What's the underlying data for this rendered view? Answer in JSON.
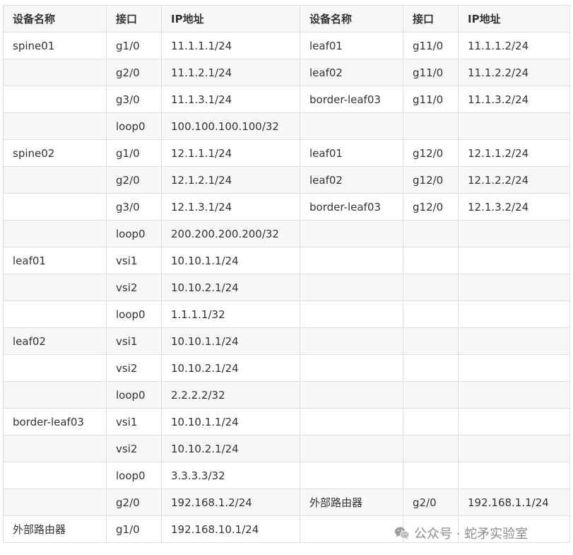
{
  "columns": [
    "设备名称",
    "接口",
    "IP地址",
    "设备名称",
    "接口",
    "IP地址"
  ],
  "rows": [
    [
      "spine01",
      "g1/0",
      "11.1.1.1/24",
      "leaf01",
      "g11/0",
      "11.1.1.2/24"
    ],
    [
      "",
      "g2/0",
      "11.1.2.1/24",
      "leaf02",
      "g11/0",
      "11.1.2.2/24"
    ],
    [
      "",
      "g3/0",
      "11.1.3.1/24",
      "border-leaf03",
      "g11/0",
      "11.1.3.2/24"
    ],
    [
      "",
      "loop0",
      "100.100.100.100/32",
      "",
      "",
      ""
    ],
    [
      "spine02",
      "g1/0",
      "12.1.1.1/24",
      "leaf01",
      "g12/0",
      "12.1.1.2/24"
    ],
    [
      "",
      "g2/0",
      "12.1.2.1/24",
      "leaf02",
      "g12/0",
      "12.1.2.2/24"
    ],
    [
      "",
      "g3/0",
      "12.1.3.1/24",
      "border-leaf03",
      "g12/0",
      "12.1.3.2/24"
    ],
    [
      "",
      "loop0",
      "200.200.200.200/32",
      "",
      "",
      ""
    ],
    [
      "leaf01",
      "vsi1",
      "10.10.1.1/24",
      "",
      "",
      ""
    ],
    [
      "",
      "vsi2",
      "10.10.2.1/24",
      "",
      "",
      ""
    ],
    [
      "",
      "loop0",
      "1.1.1.1/32",
      "",
      "",
      ""
    ],
    [
      "leaf02",
      "vsi1",
      "10.10.1.1/24",
      "",
      "",
      ""
    ],
    [
      "",
      "vsi2",
      "10.10.2.1/24",
      "",
      "",
      ""
    ],
    [
      "",
      "loop0",
      "2.2.2.2/32",
      "",
      "",
      ""
    ],
    [
      "border-leaf03",
      "vsi1",
      "10.10.1.1/24",
      "",
      "",
      ""
    ],
    [
      "",
      "vsi2",
      "10.10.2.1/24",
      "",
      "",
      ""
    ],
    [
      "",
      "loop0",
      "3.3.3.3/32",
      "",
      "",
      ""
    ],
    [
      "",
      "g2/0",
      "192.168.1.2/24",
      "外部路由器",
      "g2/0",
      "192.168.1.1/24"
    ],
    [
      "外部路由器",
      "g1/0",
      "192.168.10.1/24",
      "",
      "",
      ""
    ]
  ],
  "watermark": {
    "icon": "wechat-icon",
    "text": "公众号 · 蛇矛实验室"
  }
}
